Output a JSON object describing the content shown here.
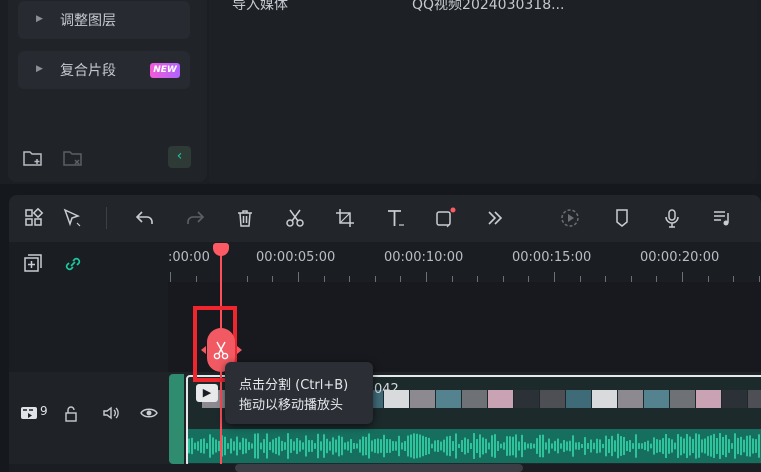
{
  "library": {
    "items": [
      {
        "label": "调整图层",
        "badge": ""
      },
      {
        "label": "复合片段",
        "badge": "NEW"
      }
    ],
    "media_row": {
      "col1": "导入媒体",
      "col2": "QQ视频2024030318..."
    }
  },
  "toolbar": {
    "buttons": [
      "layout-grid",
      "select",
      "undo",
      "redo",
      "delete",
      "cut",
      "crop",
      "text",
      "shape",
      "more",
      "speed",
      "marker",
      "voiceover",
      "music"
    ]
  },
  "ruler": {
    "ticks": [
      ":00:00",
      "00:00:05:00",
      "00:00:10:00",
      "00:00:15:00",
      "00:00:20:00"
    ]
  },
  "track": {
    "index_label": "9",
    "clip_title": "042"
  },
  "tooltip": {
    "line1": "点击分割 (Ctrl+B)",
    "line2": "拖动以移动播放头"
  },
  "colors": {
    "accent": "#19c9a0",
    "playhead": "#ff4d5a",
    "highlight": "#f0262f",
    "wave": "#166e5f"
  }
}
